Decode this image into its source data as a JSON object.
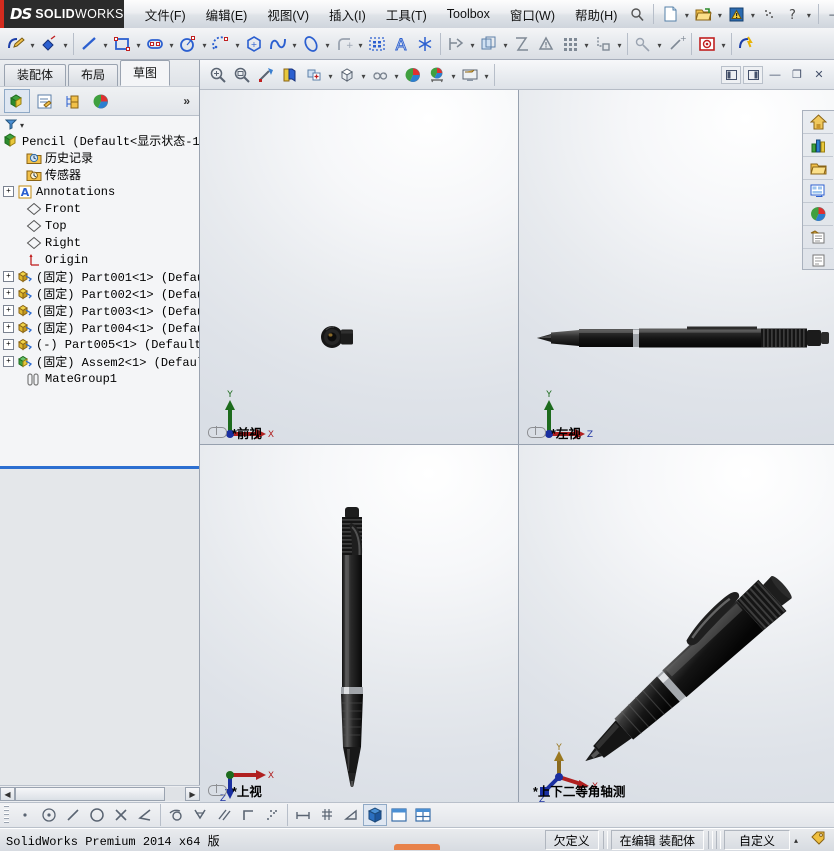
{
  "app": {
    "brand_ds": "DS",
    "brand_name": "SOLID",
    "brand_name_light": "WORKS",
    "accent_red": "#d42b1e",
    "logo_bg": "#2b2b2b"
  },
  "menubar": {
    "items": [
      {
        "label": "文件(F)",
        "name": "menu-file"
      },
      {
        "label": "编辑(E)",
        "name": "menu-edit"
      },
      {
        "label": "视图(V)",
        "name": "menu-view"
      },
      {
        "label": "插入(I)",
        "name": "menu-insert"
      },
      {
        "label": "工具(T)",
        "name": "menu-tools"
      },
      {
        "label": "Toolbox",
        "name": "menu-toolbox"
      },
      {
        "label": "窗口(W)",
        "name": "menu-window"
      },
      {
        "label": "帮助(H)",
        "name": "menu-help"
      }
    ],
    "search_icon": "search-icon",
    "quick_access": [
      {
        "name": "new-document-icon",
        "glyph": "📄"
      },
      {
        "name": "open-document-icon",
        "glyph": "📂"
      },
      {
        "name": "rebuild-icon",
        "glyph": "⚠"
      },
      {
        "name": "options-icon",
        "glyph": "⋰"
      },
      {
        "name": "help-question-icon",
        "glyph": "?"
      }
    ],
    "window_controls": [
      {
        "name": "minimize-window-button",
        "glyph": "—"
      },
      {
        "name": "restore-window-button",
        "glyph": "❐"
      },
      {
        "name": "close-window-button",
        "glyph": "✕"
      }
    ]
  },
  "command_toolbar": {
    "tools": [
      {
        "name": "sketch-tool",
        "label": "草图绘制"
      },
      {
        "name": "smart-dimension-tool",
        "label": "智能尺寸"
      },
      {
        "name": "line-tool",
        "label": "直线"
      },
      {
        "name": "rectangle-tool",
        "label": "边角矩形"
      },
      {
        "name": "slot-tool",
        "label": "直槽口"
      },
      {
        "name": "circle-tool",
        "label": "圆"
      },
      {
        "name": "arc-tool",
        "label": "圆心/起终点画弧"
      },
      {
        "name": "polygon-tool",
        "label": "多边形"
      },
      {
        "name": "spline-tool",
        "label": "样条曲线"
      },
      {
        "name": "ellipse-tool",
        "label": "椭圆"
      },
      {
        "name": "fillet-tool",
        "label": "绘制圆角"
      },
      {
        "name": "trim-entities-tool",
        "label": "剪裁实体"
      },
      {
        "name": "text-tool",
        "label": "文字"
      },
      {
        "name": "point-tool",
        "label": "点"
      },
      {
        "name": "convert-entities-tool",
        "label": "转换实体引用"
      },
      {
        "name": "offset-entities-tool",
        "label": "等距实体"
      },
      {
        "name": "mirror-entities-tool",
        "label": "镜向实体"
      },
      {
        "name": "display-delete-relations-tool",
        "label": "显示/删除几何关系"
      },
      {
        "name": "linear-pattern-tool",
        "label": "线性草图阵列"
      },
      {
        "name": "move-entities-tool",
        "label": "移动实体"
      },
      {
        "name": "repair-sketch-tool",
        "label": "修复草图"
      },
      {
        "name": "quick-snaps-tool",
        "label": "快速捕捉"
      },
      {
        "name": "instant3d-tool",
        "label": "Instant3D"
      },
      {
        "name": "rapid-sketch-tool",
        "label": "快速草图"
      }
    ]
  },
  "left_panel": {
    "tabs": [
      {
        "label": "装配体",
        "name": "tab-assembly",
        "active": false
      },
      {
        "label": "布局",
        "name": "tab-layout",
        "active": false
      },
      {
        "label": "草图",
        "name": "tab-sketch",
        "active": true
      }
    ],
    "manager_tabs": [
      {
        "name": "feature-manager-tab",
        "selected": true
      },
      {
        "name": "property-manager-tab",
        "selected": false
      },
      {
        "name": "configuration-manager-tab",
        "selected": false
      },
      {
        "name": "display-manager-tab",
        "selected": false
      }
    ],
    "overflow_label": "»",
    "filter_icon": "filter-icon",
    "filter_caret": "▾",
    "tree": [
      {
        "label": "Pencil  (Default<显示状态-1>",
        "icon": "assembly-icon",
        "expander": "",
        "indent": 0,
        "name": "tree-item-root"
      },
      {
        "label": "历史记录",
        "icon": "history-icon",
        "expander": "",
        "indent": 1,
        "name": "tree-item-history"
      },
      {
        "label": "传感器",
        "icon": "sensors-icon",
        "expander": "",
        "indent": 1,
        "name": "tree-item-sensors"
      },
      {
        "label": "Annotations",
        "icon": "annotations-icon",
        "expander": "+",
        "indent": 1,
        "name": "tree-item-annotations"
      },
      {
        "label": "Front",
        "icon": "plane-icon",
        "expander": "",
        "indent": 1,
        "name": "tree-item-front-plane"
      },
      {
        "label": "Top",
        "icon": "plane-icon",
        "expander": "",
        "indent": 1,
        "name": "tree-item-top-plane"
      },
      {
        "label": "Right",
        "icon": "plane-icon",
        "expander": "",
        "indent": 1,
        "name": "tree-item-right-plane"
      },
      {
        "label": "Origin",
        "icon": "origin-icon",
        "expander": "",
        "indent": 1,
        "name": "tree-item-origin"
      },
      {
        "label": "(固定) Part001<1>  (Defaul",
        "icon": "part-icon",
        "expander": "+",
        "indent": 1,
        "name": "tree-item-part001"
      },
      {
        "label": "(固定) Part002<1>  (Defaul",
        "icon": "part-icon",
        "expander": "+",
        "indent": 1,
        "name": "tree-item-part002"
      },
      {
        "label": "(固定) Part003<1>  (Defaul",
        "icon": "part-icon",
        "expander": "+",
        "indent": 1,
        "name": "tree-item-part003"
      },
      {
        "label": "(固定) Part004<1>  (Defaul",
        "icon": "part-icon",
        "expander": "+",
        "indent": 1,
        "name": "tree-item-part004"
      },
      {
        "label": "(-) Part005<1>  (Default)",
        "icon": "part-icon",
        "expander": "+",
        "indent": 1,
        "name": "tree-item-part005"
      },
      {
        "label": "(固定) Assem2<1>  (Default",
        "icon": "subassembly-icon",
        "expander": "+",
        "indent": 1,
        "name": "tree-item-assem2"
      },
      {
        "label": "MateGroup1",
        "icon": "mategroup-icon",
        "expander": "",
        "indent": 1,
        "name": "tree-item-mategroup1"
      }
    ],
    "scroll_left_arrow": "◀",
    "scroll_right_arrow": "▶"
  },
  "view_toolbar": {
    "tools": [
      {
        "name": "zoom-to-fit-icon",
        "label": "整屏显示全图"
      },
      {
        "name": "zoom-to-area-icon",
        "label": "局部放大"
      },
      {
        "name": "previous-view-icon",
        "label": "上一视图"
      },
      {
        "name": "section-view-icon",
        "label": "剖面视图"
      },
      {
        "name": "view-orientation-icon",
        "label": "视图定向"
      },
      {
        "name": "display-style-icon",
        "label": "显示样式"
      },
      {
        "name": "hide-show-items-icon",
        "label": "隐藏/显示项目"
      },
      {
        "name": "edit-appearance-icon",
        "label": "编辑外观"
      },
      {
        "name": "apply-scene-icon",
        "label": "应用布景"
      },
      {
        "name": "view-settings-icon",
        "label": "视图设定"
      }
    ],
    "window_tools": [
      {
        "name": "split-vertical-icon",
        "glyph": "◫"
      },
      {
        "name": "split-horizontal-icon",
        "glyph": "◫"
      },
      {
        "name": "minimize-doc-button",
        "glyph": "—"
      },
      {
        "name": "restore-doc-button",
        "glyph": "❐"
      },
      {
        "name": "close-doc-button",
        "glyph": "✕"
      }
    ]
  },
  "right_toolbar": {
    "items": [
      {
        "name": "home-icon",
        "label": "主页"
      },
      {
        "name": "resources-icon",
        "label": "SolidWorks 资源"
      },
      {
        "name": "design-library-icon",
        "label": "设计库"
      },
      {
        "name": "file-explorer-icon",
        "label": "文件探索器"
      },
      {
        "name": "view-palette-icon",
        "label": "视图调色板"
      },
      {
        "name": "appearances-scenes-icon",
        "label": "外观布景贴图"
      },
      {
        "name": "custom-properties-icon",
        "label": "自定义属性"
      }
    ]
  },
  "viewports": [
    {
      "name": "viewport-front",
      "label": "*前视",
      "link_icon": "linked-views-icon",
      "triad": "xy"
    },
    {
      "name": "viewport-left",
      "label": "*左视",
      "link_icon": "linked-views-icon",
      "triad": "zy"
    },
    {
      "name": "viewport-top",
      "label": "*上视",
      "link_icon": "linked-views-icon",
      "triad": "xz"
    },
    {
      "name": "viewport-isometric",
      "label": "*上下二等角轴测",
      "link_icon": "",
      "triad": "iso"
    }
  ],
  "triad_labels": {
    "x": "X",
    "y": "Y",
    "z": "Z"
  },
  "sketch_statusbar": {
    "tools": [
      {
        "name": "point-entity-icon",
        "glyph": "·",
        "selected": false
      },
      {
        "name": "center-point-icon",
        "glyph": "⊙",
        "selected": false
      },
      {
        "name": "line-entity-icon",
        "glyph": "╱",
        "selected": false
      },
      {
        "name": "circle-entity-icon",
        "glyph": "◯",
        "selected": false
      },
      {
        "name": "intersection-icon",
        "glyph": "✕",
        "selected": false
      },
      {
        "name": "angle-icon",
        "glyph": "∠",
        "selected": false
      },
      {
        "name": "tangent-icon",
        "glyph": "⌒",
        "selected": false
      },
      {
        "name": "perpendicular-snap-icon",
        "glyph": "⊻",
        "selected": false
      },
      {
        "name": "parallel-icon",
        "glyph": "∥",
        "selected": false
      },
      {
        "name": "horizontal-vertical-icon",
        "glyph": "⌐",
        "selected": false
      },
      {
        "name": "nearest-icon",
        "glyph": "⁘",
        "selected": false
      },
      {
        "name": "length-snap-icon",
        "glyph": "⊢",
        "selected": false
      },
      {
        "name": "grid-snap-icon",
        "glyph": "▦",
        "selected": false
      },
      {
        "name": "angle-snap-icon",
        "glyph": "◿",
        "selected": false
      },
      {
        "name": "shaded-view-icon",
        "glyph": "",
        "selected": true
      },
      {
        "name": "single-view-icon",
        "glyph": "",
        "selected": false
      },
      {
        "name": "four-view-icon",
        "glyph": "",
        "selected": false
      }
    ]
  },
  "statusbar": {
    "version_text": "SolidWorks Premium 2014 x64 版",
    "state": "欠定义",
    "editing": "在编辑  装配体",
    "custom": "自定义",
    "custom_caret": "▴",
    "tag_icon": "tag-icon"
  }
}
